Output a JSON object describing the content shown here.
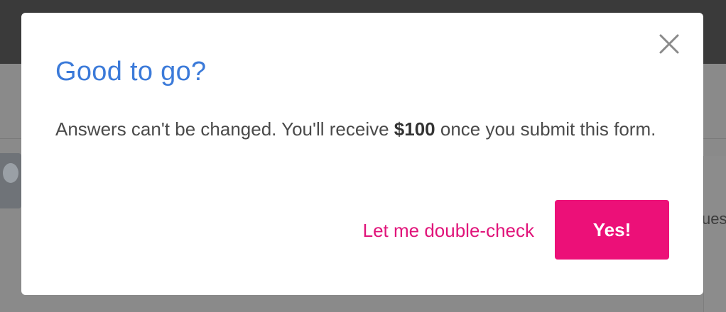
{
  "background": {
    "partial_text": "ues"
  },
  "dialog": {
    "title": "Good to go?",
    "message_prefix": "Answers can't be changed. You'll receive ",
    "amount": "$100",
    "message_suffix": " once you submit this form.",
    "close_icon": "close-icon",
    "secondary_button_label": "Let me double-check",
    "primary_button_label": "Yes!"
  },
  "colors": {
    "title": "#3b7ad9",
    "accent": "#ec1078",
    "secondary_text": "#e0147a",
    "body_text": "#4a4a4a"
  }
}
